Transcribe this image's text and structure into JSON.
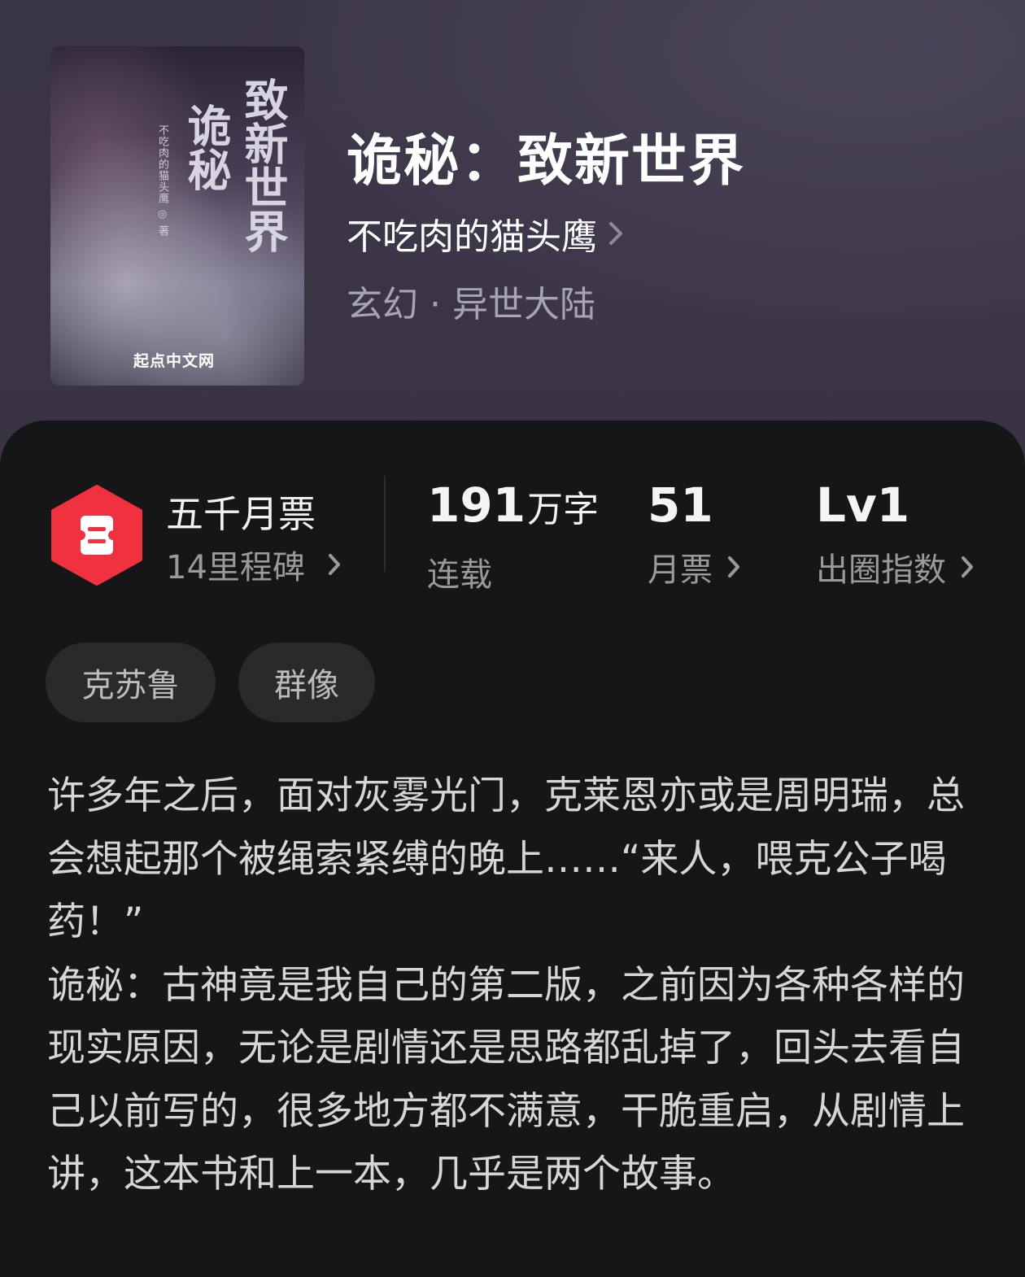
{
  "book": {
    "title": "诡秘：致新世界",
    "author": "不吃肉的猫头鹰",
    "genre": "玄幻 · 异世大陆",
    "cover": {
      "title_col1": "致新世界",
      "title_col2": "诡秘",
      "author_line": "不吃肉的猫头鹰 ◎ 著",
      "publisher": "起点中文网"
    }
  },
  "monthly_pass": {
    "title": "五千月票",
    "subtitle": "14里程碑",
    "icon": "ticket-icon",
    "badge_color": "#f0313f"
  },
  "stats": [
    {
      "value": "191",
      "unit": "万字",
      "label": "连载"
    },
    {
      "value": "51",
      "label": "月票"
    },
    {
      "value": "Lv1",
      "label": "出圈指数"
    }
  ],
  "tags": [
    "克苏鲁",
    "群像"
  ],
  "description": {
    "para1": "许多年之后，面对灰雾光门，克莱恩亦或是周明瑞，总会想起那个被绳索紧缚的晚上……“来人，喂克公子喝药！”",
    "para2": "诡秘：古神竟是我自己的第二版，之前因为各种各样的现实原因，无论是剧情还是思路都乱掉了，回头去看自己以前写的，很多地方都不满意，干脆重启，从剧情上讲，这本书和上一本，几乎是两个故事。"
  }
}
